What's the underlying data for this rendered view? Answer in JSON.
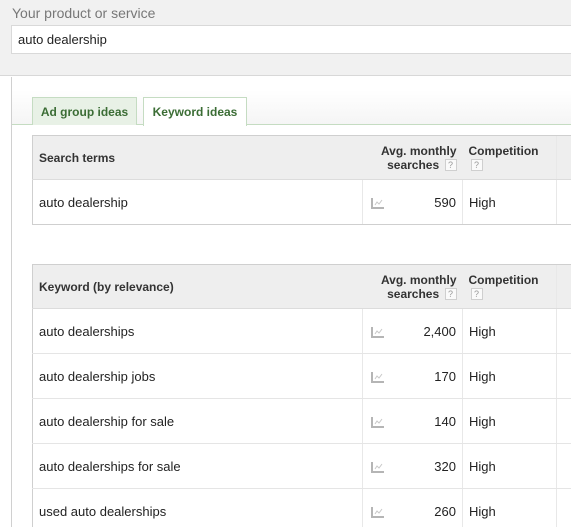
{
  "product_section": {
    "label": "Your product or service",
    "input_value": "auto dealership"
  },
  "tabs": [
    {
      "label": "Ad group ideas",
      "active": false
    },
    {
      "label": "Keyword ideas",
      "active": true
    }
  ],
  "search_terms_table": {
    "headers": {
      "term": "Search terms",
      "searches_line1": "Avg. monthly",
      "searches_line2": "searches",
      "competition": "Competition",
      "help": "?"
    },
    "rows": [
      {
        "term": "auto dealership",
        "trend_icon": "trend-chart-icon",
        "searches": "590",
        "competition": "High"
      }
    ]
  },
  "keyword_ideas_table": {
    "headers": {
      "keyword": "Keyword (by relevance)",
      "searches_line1": "Avg. monthly",
      "searches_line2": "searches",
      "competition": "Competition",
      "help": "?"
    },
    "rows": [
      {
        "keyword": "auto dealerships",
        "trend_icon": "trend-chart-icon",
        "searches": "2,400",
        "competition": "High"
      },
      {
        "keyword": "auto dealership jobs",
        "trend_icon": "trend-chart-icon",
        "searches": "170",
        "competition": "High"
      },
      {
        "keyword": "auto dealership for sale",
        "trend_icon": "trend-chart-icon",
        "searches": "140",
        "competition": "High"
      },
      {
        "keyword": "auto dealerships for sale",
        "trend_icon": "trend-chart-icon",
        "searches": "320",
        "competition": "High"
      },
      {
        "keyword": "used auto dealerships",
        "trend_icon": "trend-chart-icon",
        "searches": "260",
        "competition": "High"
      }
    ]
  },
  "colors": {
    "tab_text": "#3b6d35",
    "tab_border": "#c5dcc2",
    "header_bg": "#eeeeee",
    "panel_bg": "#f1f1f1"
  }
}
